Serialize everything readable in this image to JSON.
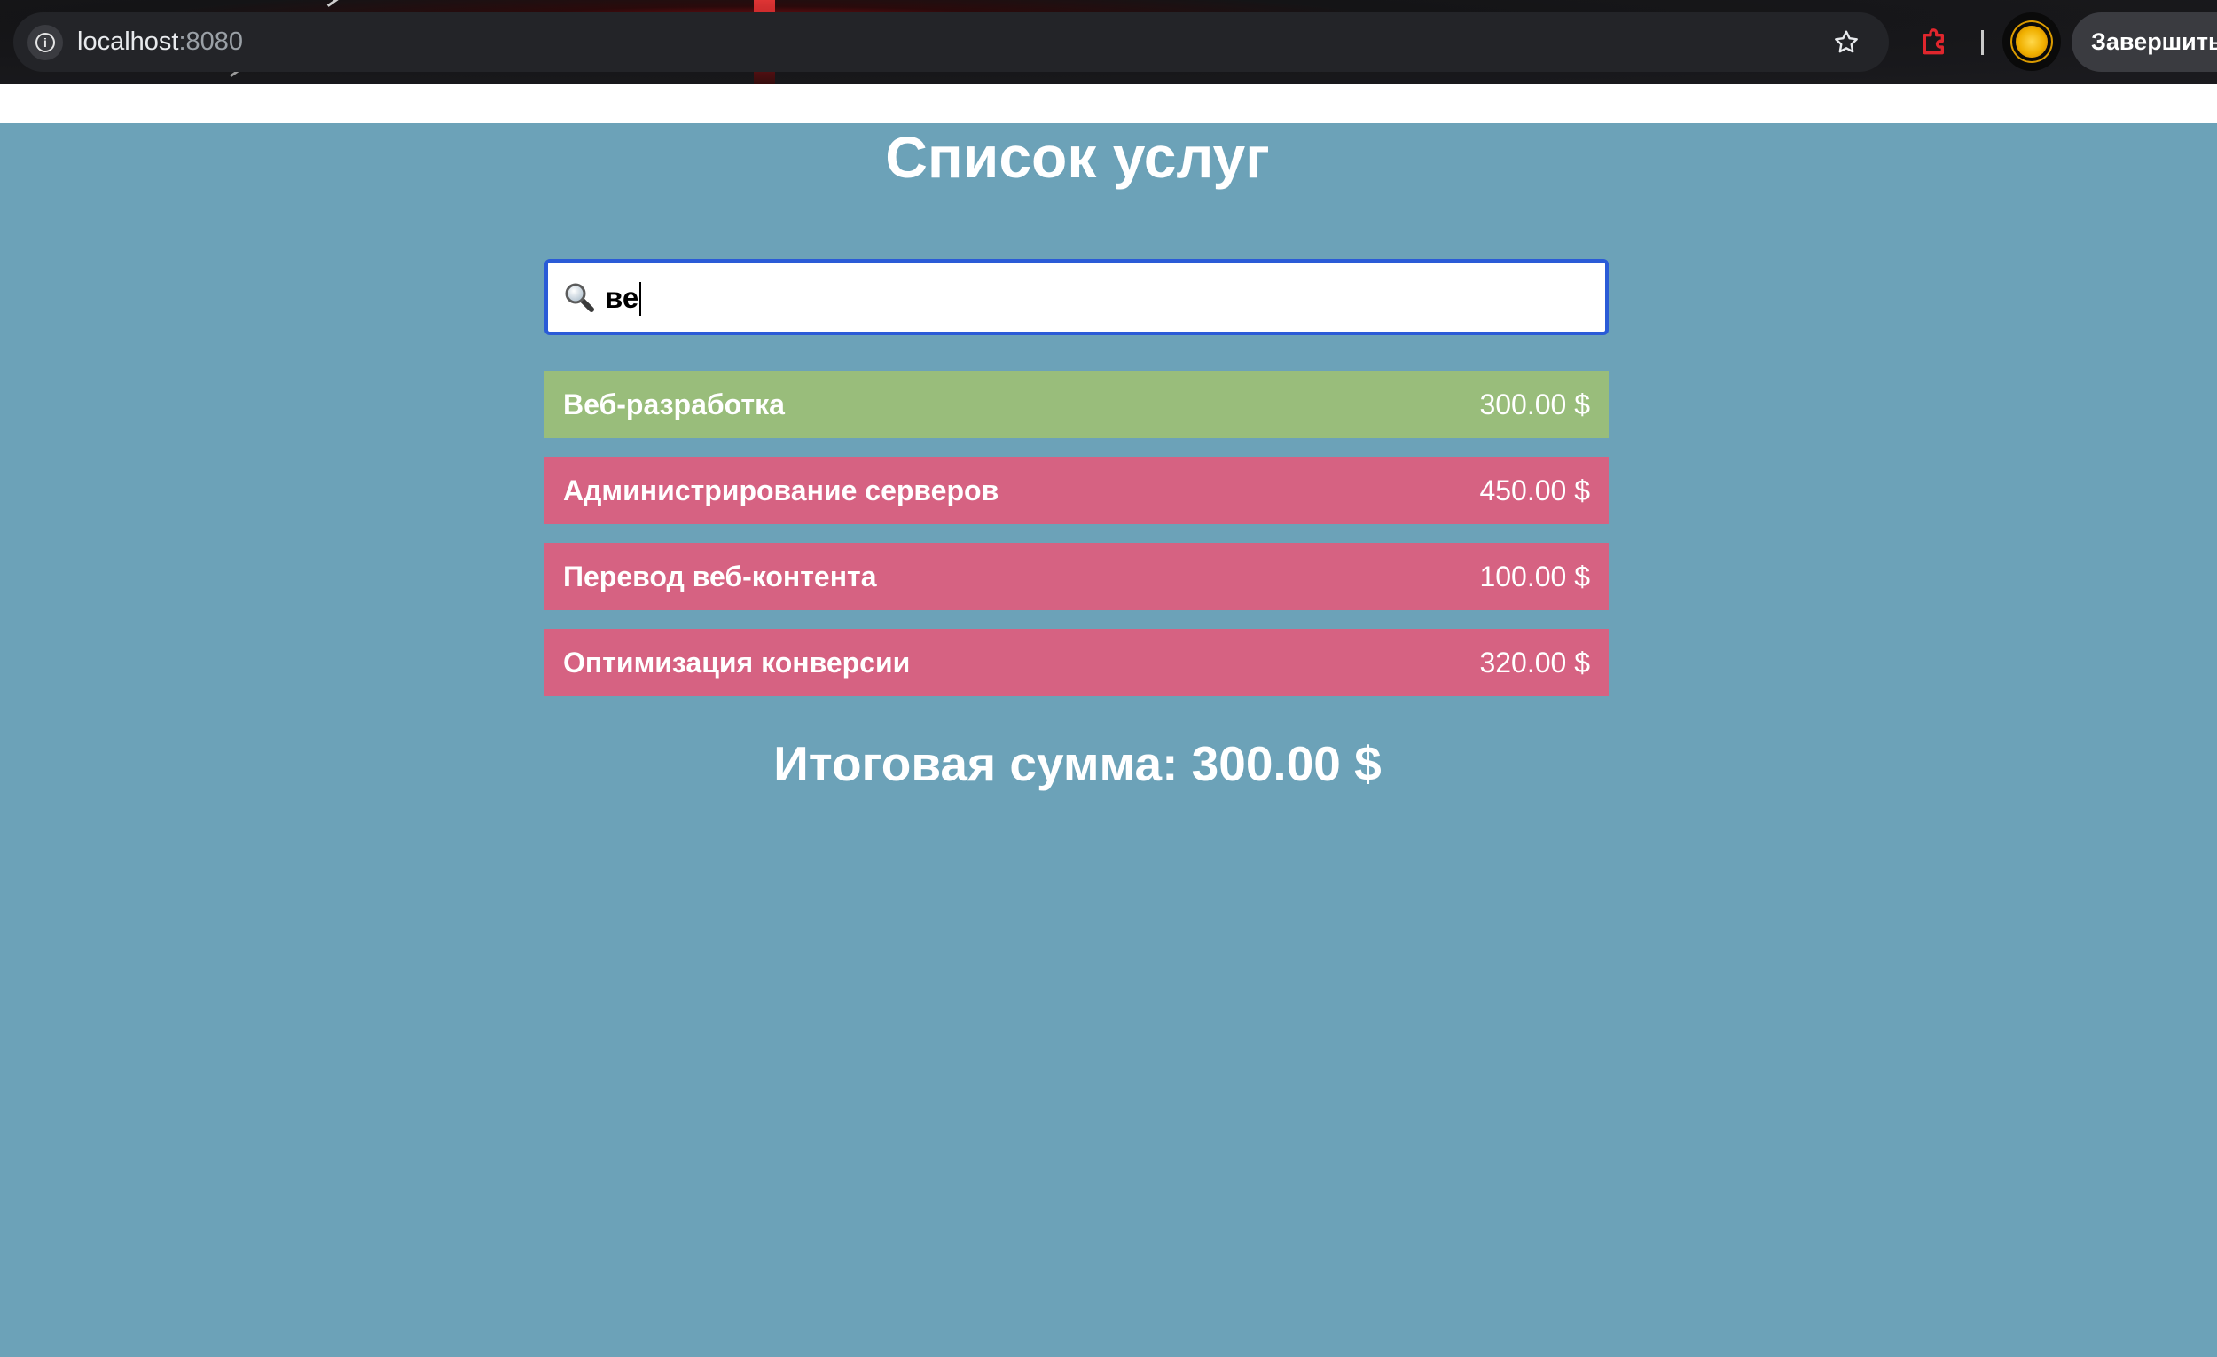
{
  "browser": {
    "url_host": "localhost",
    "url_port": ":8080",
    "finish_button_label": "Завершить"
  },
  "page": {
    "title": "Список услуг",
    "search": {
      "value": "ве"
    },
    "services": [
      {
        "name": "Веб-разработка",
        "price": "300.00 $",
        "selected": true
      },
      {
        "name": "Администрирование серверов",
        "price": "450.00 $",
        "selected": false
      },
      {
        "name": "Перевод веб-контента",
        "price": "100.00 $",
        "selected": false
      },
      {
        "name": "Оптимизация конверсии",
        "price": "320.00 $",
        "selected": false
      }
    ],
    "total_text": "Итоговая сумма: 300.00 $"
  },
  "colors": {
    "background": "#6ca2b8",
    "selected_row": "#99bd7b",
    "unselected_row": "#d66282",
    "search_border": "#2a5bd7"
  },
  "icons": {
    "info": "info-icon",
    "bookmark": "star-icon",
    "extension": "extension-icon",
    "profile": "avatar",
    "search": "magnifier-icon"
  }
}
